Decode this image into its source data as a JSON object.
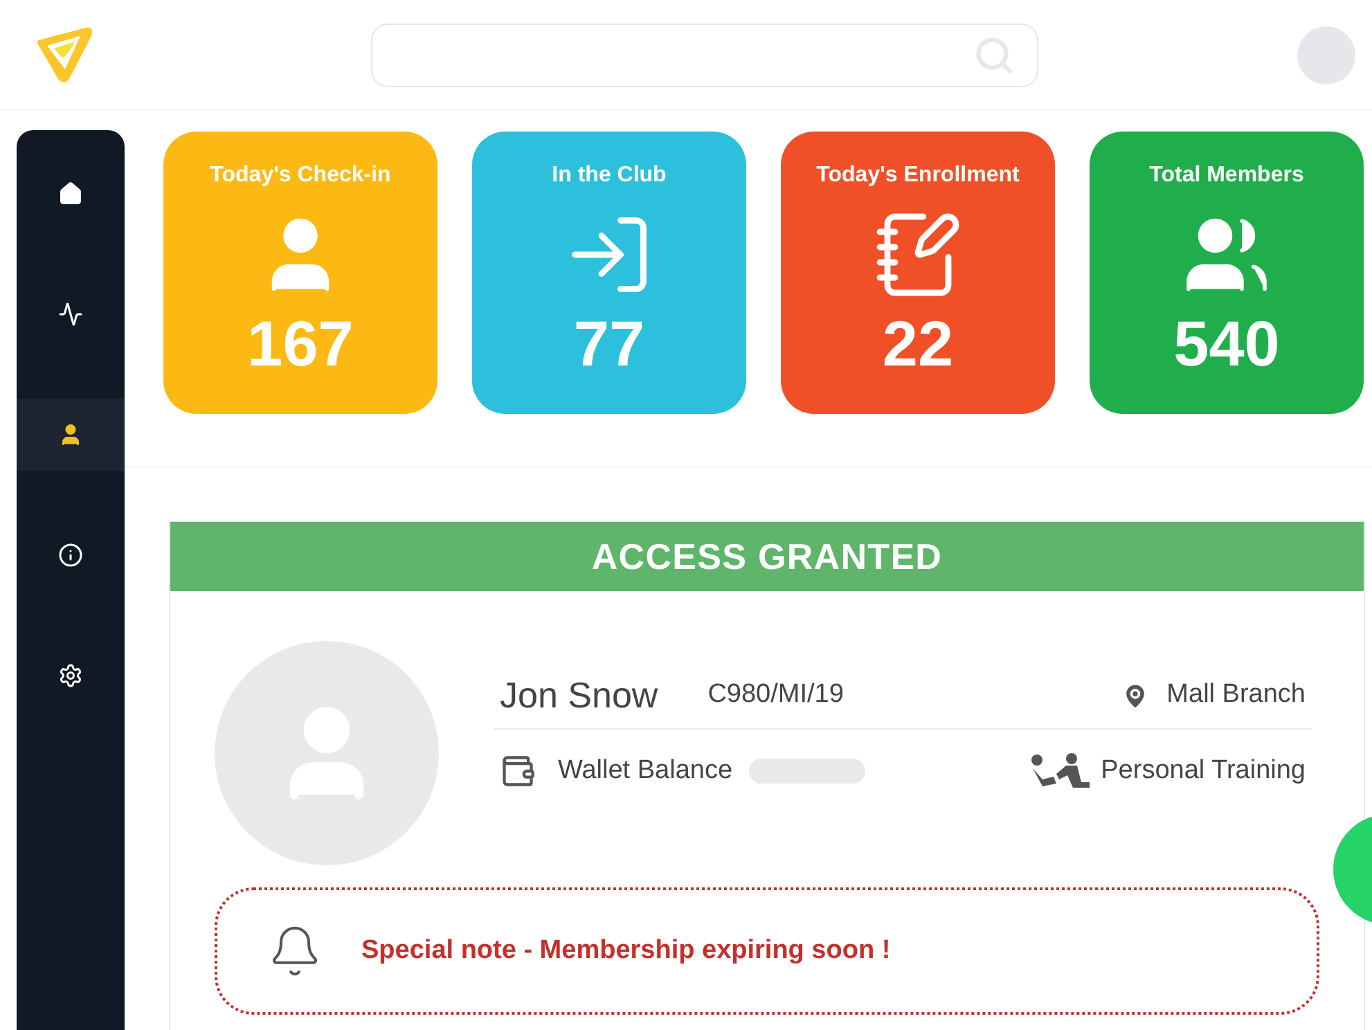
{
  "sidebar": {
    "items": [
      {
        "kind": "home",
        "selected": false
      },
      {
        "kind": "activity",
        "selected": false
      },
      {
        "kind": "member",
        "selected": true
      },
      {
        "kind": "info",
        "selected": false
      },
      {
        "kind": "settings",
        "selected": false
      }
    ]
  },
  "stats": [
    {
      "kind": "checkin",
      "title": "Today's Check-in",
      "value": "167",
      "color": "#fdb913"
    },
    {
      "kind": "club",
      "title": "In the Club",
      "value": "77",
      "color": "#2cc0dc"
    },
    {
      "kind": "enrollment",
      "title": "Today's Enrollment",
      "value": "22",
      "color": "#f05027"
    },
    {
      "kind": "members",
      "title": "Total Members",
      "value": "540",
      "color": "#1fae4b"
    }
  ],
  "access": {
    "status": "ACCESS GRANTED",
    "name": "Jon Snow",
    "member_id": "C980/MI/19",
    "branch": "Mall Branch",
    "wallet_label": "Wallet Balance",
    "plan": "Personal Training",
    "note": "Special note - Membership expiring soon !"
  }
}
